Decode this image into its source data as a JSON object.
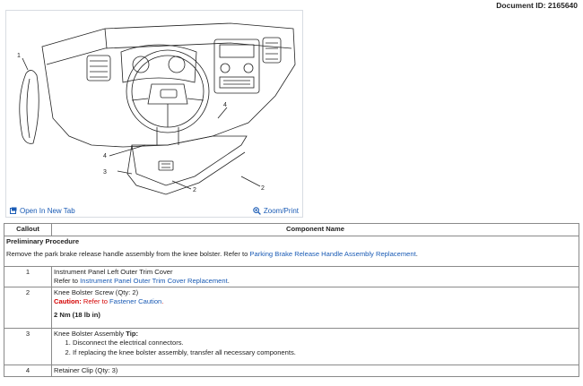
{
  "document_id": "Document ID: 2165640",
  "figure": {
    "callouts": [
      "1",
      "2",
      "2",
      "3",
      "4",
      "4"
    ],
    "open_new_tab": "Open In New Tab",
    "zoom_print": "Zoom/Print"
  },
  "table": {
    "headers": [
      "Callout",
      "Component Name"
    ],
    "preliminary": {
      "title": "Preliminary Procedure",
      "text": "Remove the park brake release handle assembly from the knee bolster. Refer to ",
      "link": "Parking Brake Release Handle Assembly Replacement",
      "end": "."
    },
    "rows": [
      {
        "callout": "1",
        "name": "Instrument Panel Left Outer Trim Cover",
        "refer": "Refer to ",
        "link": "Instrument Panel Outer Trim Cover Replacement",
        "end": "."
      },
      {
        "callout": "2",
        "name": "Knee Bolster Screw (Qty: 2)",
        "caution_label": "Caution:",
        "caution_text": " Refer to ",
        "caution_link": "Fastener Caution",
        "caution_end": ".",
        "torque": "2 Nm (18 lb in)"
      },
      {
        "callout": "3",
        "name": "Knee Bolster Assembly ",
        "tip_label": "Tip:",
        "steps": [
          "Disconnect the electrical connectors.",
          "If replacing the knee bolster assembly, transfer all necessary components."
        ]
      },
      {
        "callout": "4",
        "name": "Retainer Clip (Qty: 3)"
      }
    ]
  }
}
